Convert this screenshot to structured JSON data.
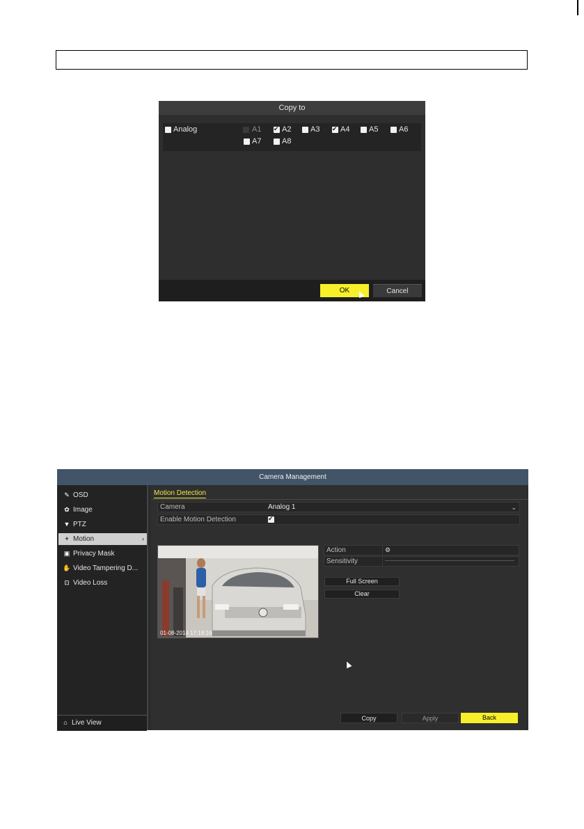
{
  "copy_dialog": {
    "title": "Copy to",
    "analog_label": "Analog",
    "channels": [
      {
        "label": "A1",
        "checked": false,
        "disabled": true
      },
      {
        "label": "A2",
        "checked": true,
        "disabled": false
      },
      {
        "label": "A3",
        "checked": false,
        "disabled": false
      },
      {
        "label": "A4",
        "checked": true,
        "disabled": false
      },
      {
        "label": "A5",
        "checked": false,
        "disabled": false
      },
      {
        "label": "A6",
        "checked": false,
        "disabled": false
      },
      {
        "label": "A7",
        "checked": false,
        "disabled": false
      },
      {
        "label": "A8",
        "checked": false,
        "disabled": false
      }
    ],
    "ok_label": "OK",
    "cancel_label": "Cancel"
  },
  "camera_management": {
    "title": "Camera Management",
    "sidebar": {
      "items": [
        {
          "label": "OSD",
          "icon": "pencil-icon"
        },
        {
          "label": "Image",
          "icon": "palette-icon"
        },
        {
          "label": "PTZ",
          "icon": "ptz-icon"
        },
        {
          "label": "Motion",
          "icon": "motion-icon"
        },
        {
          "label": "Privacy Mask",
          "icon": "mask-icon"
        },
        {
          "label": "Video Tampering D...",
          "icon": "hand-icon"
        },
        {
          "label": "Video Loss",
          "icon": "video-loss-icon"
        }
      ],
      "live_view": "Live View"
    },
    "tab": "Motion Detection",
    "camera_label": "Camera",
    "camera_value": "Analog 1",
    "enable_label": "Enable Motion Detection",
    "enable_checked": true,
    "preview_timestamp": "01-08-2014 17:18:16",
    "action_label": "Action",
    "sensitivity_label": "Sensitivity",
    "full_screen_label": "Full Screen",
    "clear_label": "Clear",
    "copy_label": "Copy",
    "apply_label": "Apply",
    "back_label": "Back"
  },
  "colors": {
    "accent_yellow": "#f7ef2a",
    "title_bar_blue": "#425467",
    "panel_dark": "#2b2b2b"
  }
}
